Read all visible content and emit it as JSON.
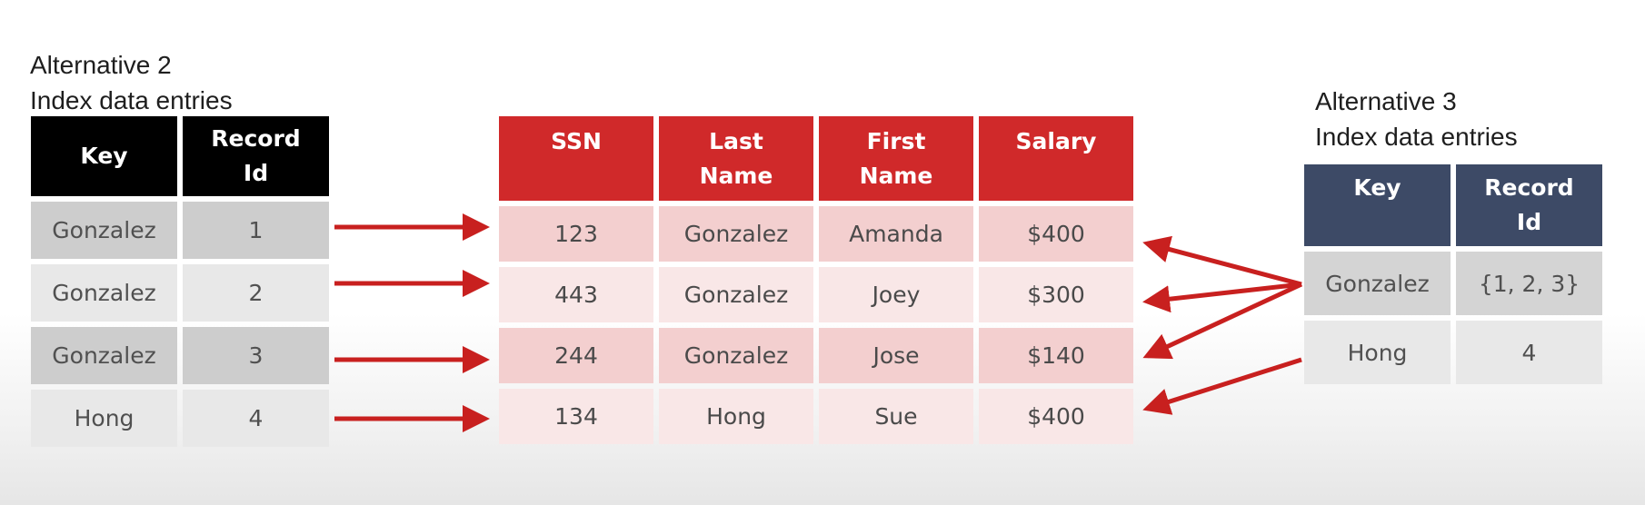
{
  "left": {
    "caption_line1": "Alternative 2",
    "caption_line2": "Index data entries",
    "headers": [
      "Key",
      "Record",
      "Id"
    ],
    "rows": [
      {
        "key": "Gonzalez",
        "rid": "1"
      },
      {
        "key": "Gonzalez",
        "rid": "2"
      },
      {
        "key": "Gonzalez",
        "rid": "3"
      },
      {
        "key": "Hong",
        "rid": "4"
      }
    ]
  },
  "main": {
    "headers": [
      "SSN",
      "Last",
      "Name",
      "First",
      "Name",
      "Salary"
    ],
    "rows": [
      {
        "ssn": "123",
        "last": "Gonzalez",
        "first": "Amanda",
        "salary": "$400"
      },
      {
        "ssn": "443",
        "last": "Gonzalez",
        "first": "Joey",
        "salary": "$300"
      },
      {
        "ssn": "244",
        "last": "Gonzalez",
        "first": "Jose",
        "salary": "$140"
      },
      {
        "ssn": "134",
        "last": "Hong",
        "first": "Sue",
        "salary": "$400"
      }
    ]
  },
  "right": {
    "caption_line1": "Alternative 3",
    "caption_line2": "Index data entries",
    "headers": [
      "Key",
      "Record",
      "Id"
    ],
    "rows": [
      {
        "key": "Gonzalez",
        "rid": "{1, 2, 3}"
      },
      {
        "key": "Hong",
        "rid": "4"
      }
    ]
  },
  "colors": {
    "alt2_header": "#000000",
    "main_header": "#d0292a",
    "alt3_header": "#3d4a66",
    "arrow": "#c8201f"
  }
}
